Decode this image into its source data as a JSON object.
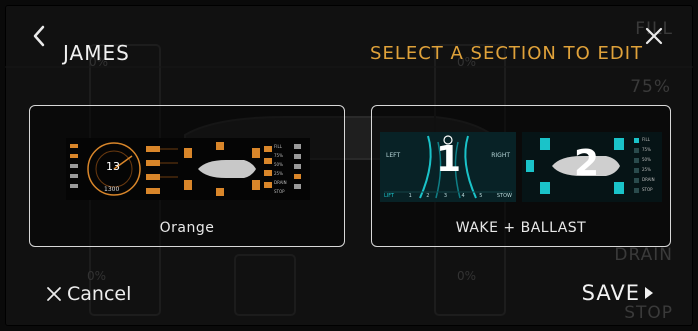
{
  "header": {
    "title": "JAMES",
    "prompt": "SELECT A SECTION TO EDIT",
    "accent_color": "#e0a23a"
  },
  "background_ghost": {
    "fill": "FILL",
    "pct_75": "75%",
    "drain": "DRAIN",
    "stop": "STOP",
    "pct_0_a": "0%",
    "pct_0_b": "0%",
    "pct_0_c": "0%",
    "pct_0_d": "0%"
  },
  "cards": [
    {
      "label": "Orange"
    },
    {
      "label": "WAKE + BALLAST"
    }
  ],
  "thumb_orange": {
    "speed": "13",
    "rpm": "1300",
    "tags": [
      "FILL",
      "75%",
      "50%",
      "25%",
      "DRAIN",
      "STOP"
    ]
  },
  "thumb_wake": {
    "left": "LEFT",
    "right": "RIGHT",
    "number": "1",
    "steps": [
      "LIFT",
      "1",
      "2",
      "3",
      "4",
      "5",
      "STOW"
    ]
  },
  "thumb_ballast": {
    "number": "2",
    "tags": [
      "FILL",
      "75%",
      "50%",
      "25%",
      "DRAIN",
      "STOP"
    ]
  },
  "footer": {
    "cancel_label": "Cancel",
    "save_label": "SAVE"
  },
  "icons": {
    "back": "chevron-left-icon",
    "close": "close-icon",
    "cancel": "x-icon",
    "save": "play-arrow-icon"
  }
}
